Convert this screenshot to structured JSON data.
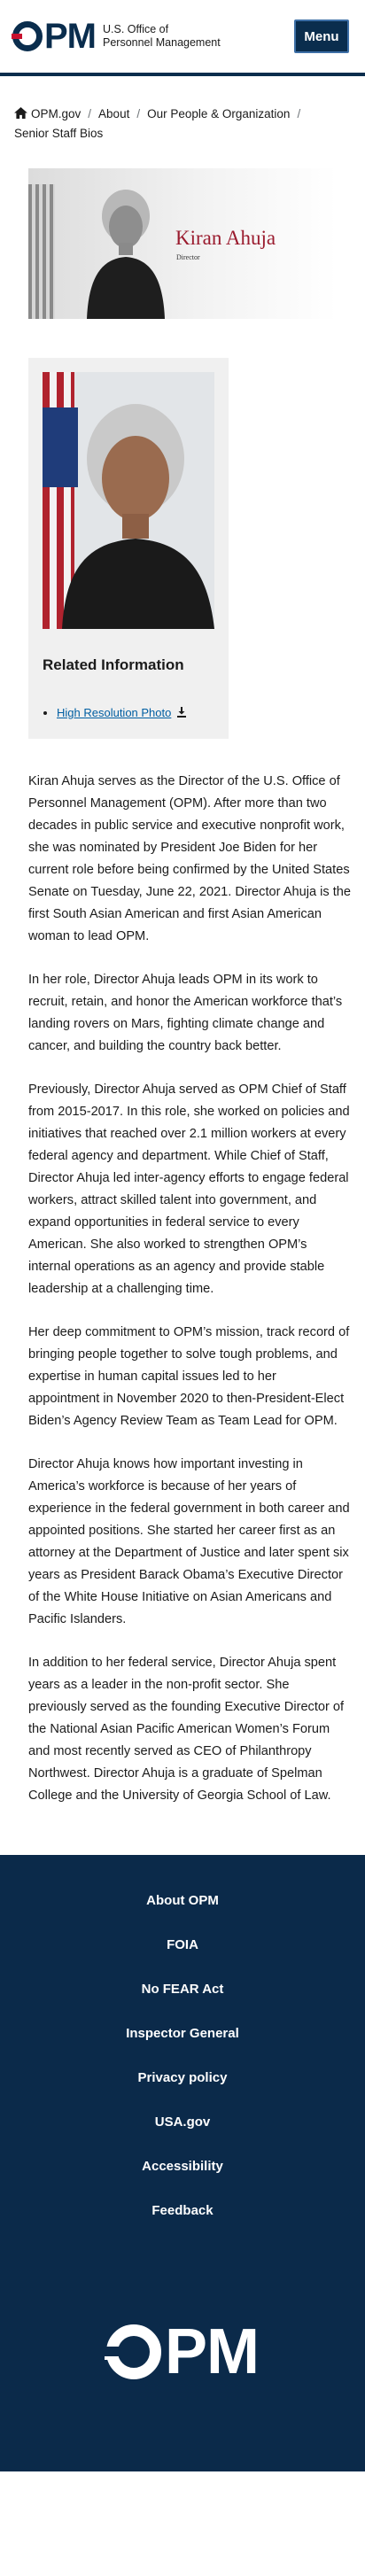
{
  "header": {
    "logo_mark": "PM",
    "logo_line1": "U.S. Office of",
    "logo_line2": "Personnel Management",
    "menu_label": "Menu"
  },
  "breadcrumb": {
    "items": [
      "OPM.gov",
      "About",
      "Our People & Organization",
      "Senior Staff Bios"
    ]
  },
  "banner": {
    "name": "Kiran Ahuja",
    "title": "Director"
  },
  "related": {
    "heading": "Related Information",
    "link_label": "High Resolution Photo"
  },
  "bio": {
    "paragraphs": [
      "Kiran Ahuja serves as the Director of the U.S. Office of Personnel Management (OPM). After more than two decades in public service and executive nonprofit work, she was nominated by President Joe Biden for her current role before being confirmed by the United States Senate on Tuesday, June 22, 2021. Director Ahuja is the first South Asian American and first Asian American woman to lead OPM.",
      "In her role, Director Ahuja leads OPM in its work to recruit, retain, and honor the American workforce that’s landing rovers on Mars, fighting climate change and cancer, and building the country back better.",
      "Previously, Director Ahuja served as OPM Chief of Staff from 2015-2017. In this role, she worked on policies and initiatives that reached over 2.1 million workers at every federal agency and department. While Chief of Staff, Director Ahuja led inter-agency efforts to engage federal workers, attract skilled talent into government, and expand opportunities in federal service to every American. She also worked to strengthen OPM’s internal operations as an agency and provide stable leadership at a challenging time.",
      "Her deep commitment to OPM’s mission, track record of bringing people together to solve tough problems, and expertise in human capital issues led to her appointment in November 2020 to then-President-Elect Biden’s Agency Review Team as Team Lead for OPM.",
      "Director Ahuja knows how important investing in America’s workforce is because of her years of experience in the federal government in both career and appointed positions. She started her career first as an attorney at the Department of Justice and later spent six years as President Barack Obama’s Executive Director of the White House Initiative on Asian Americans and Pacific Islanders.",
      "In addition to her federal service, Director Ahuja spent years as a leader in the non-profit sector. She previously served as the founding Executive Director of the National Asian Pacific American Women’s Forum and most recently served as CEO of Philanthropy Northwest. Director Ahuja is a graduate of Spelman College and the University of Georgia School of Law."
    ]
  },
  "footer": {
    "links": [
      "About OPM",
      "FOIA",
      "No FEAR Act",
      "Inspector General",
      "Privacy policy",
      "USA.gov",
      "Accessibility",
      "Feedback"
    ],
    "logo_mark": "PM"
  },
  "colors": {
    "navy": "#0a2d4d",
    "accent_red": "#c8102e",
    "link_blue": "#005ea2",
    "footer_bg": "#0b2a4a"
  }
}
